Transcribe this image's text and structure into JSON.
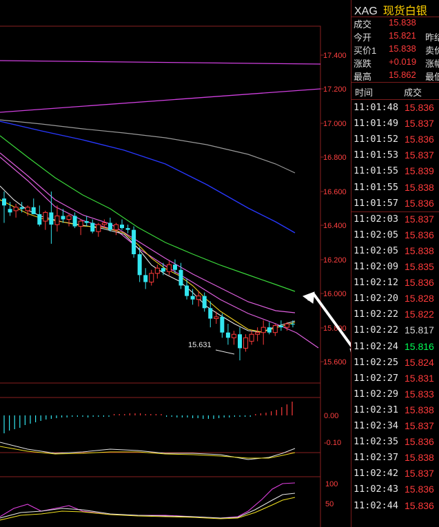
{
  "header": {
    "symbol": "XAG",
    "name": "现货白银"
  },
  "quote_rows": [
    {
      "label": "成交",
      "value": "15.838",
      "extra": ""
    },
    {
      "label": "今开",
      "value": "15.821",
      "extra": "昨结"
    },
    {
      "label": "买价1",
      "value": "15.838",
      "extra": "卖价"
    },
    {
      "label": "涨跌",
      "value": "+0.019",
      "extra": "涨幅"
    },
    {
      "label": "最高",
      "value": "15.862",
      "extra": "最低"
    }
  ],
  "trades_header": {
    "time": "时间",
    "price": "成交"
  },
  "trades": [
    {
      "time": "11:01:48",
      "price": "15.836",
      "dir": "up"
    },
    {
      "time": "11:01:49",
      "price": "15.837",
      "dir": "up"
    },
    {
      "time": "11:01:52",
      "price": "15.836",
      "dir": "up"
    },
    {
      "time": "11:01:53",
      "price": "15.837",
      "dir": "up"
    },
    {
      "time": "11:01:55",
      "price": "15.839",
      "dir": "up"
    },
    {
      "time": "11:01:55",
      "price": "15.838",
      "dir": "up"
    },
    {
      "time": "11:01:57",
      "price": "15.836",
      "dir": "up"
    },
    {
      "time": "11:02:03",
      "price": "15.837",
      "dir": "up"
    },
    {
      "time": "11:02:05",
      "price": "15.836",
      "dir": "up"
    },
    {
      "time": "11:02:05",
      "price": "15.838",
      "dir": "up"
    },
    {
      "time": "11:02:09",
      "price": "15.835",
      "dir": "up"
    },
    {
      "time": "11:02:12",
      "price": "15.836",
      "dir": "up"
    },
    {
      "time": "11:02:20",
      "price": "15.828",
      "dir": "up"
    },
    {
      "time": "11:02:22",
      "price": "15.822",
      "dir": "up"
    },
    {
      "time": "11:02:22",
      "price": "15.817",
      "dir": "flat"
    },
    {
      "time": "11:02:24",
      "price": "15.816",
      "dir": "down"
    },
    {
      "time": "11:02:25",
      "price": "15.824",
      "dir": "up"
    },
    {
      "time": "11:02:27",
      "price": "15.831",
      "dir": "up"
    },
    {
      "time": "11:02:29",
      "price": "15.833",
      "dir": "up"
    },
    {
      "time": "11:02:31",
      "price": "15.838",
      "dir": "up"
    },
    {
      "time": "11:02:34",
      "price": "15.837",
      "dir": "up"
    },
    {
      "time": "11:02:35",
      "price": "15.836",
      "dir": "up"
    },
    {
      "time": "11:02:37",
      "price": "15.838",
      "dir": "up"
    },
    {
      "time": "11:02:42",
      "price": "15.837",
      "dir": "up"
    },
    {
      "time": "11:02:43",
      "price": "15.836",
      "dir": "up"
    },
    {
      "time": "11:02:44",
      "price": "15.836",
      "dir": "up"
    }
  ],
  "price_axis": [
    "17.400",
    "17.200",
    "17.000",
    "16.800",
    "16.600",
    "16.400",
    "16.200",
    "16.000",
    "15.800",
    "15.600"
  ],
  "macd_axis": [
    "0.00",
    "-0.10"
  ],
  "kdj_axis": [
    "100",
    "50"
  ],
  "low_label": "15.631",
  "colors": {
    "up": "#ff3b3b",
    "down": "#00ff55",
    "flat": "#d8d8d8",
    "grid": "#8a1f1f"
  },
  "chart_data": {
    "type": "candlestick",
    "price_range": [
      15.5,
      17.55
    ],
    "candles": [
      {
        "o": 16.56,
        "h": 16.6,
        "l": 16.42,
        "c": 16.52
      },
      {
        "o": 16.5,
        "h": 16.54,
        "l": 16.46,
        "c": 16.48
      },
      {
        "o": 16.49,
        "h": 16.53,
        "l": 16.45,
        "c": 16.51
      },
      {
        "o": 16.51,
        "h": 16.54,
        "l": 16.48,
        "c": 16.5
      },
      {
        "o": 16.49,
        "h": 16.52,
        "l": 16.46,
        "c": 16.51
      },
      {
        "o": 16.51,
        "h": 16.56,
        "l": 16.48,
        "c": 16.47
      },
      {
        "o": 16.47,
        "h": 16.52,
        "l": 16.4,
        "c": 16.41
      },
      {
        "o": 16.43,
        "h": 16.49,
        "l": 16.38,
        "c": 16.48
      },
      {
        "o": 16.48,
        "h": 16.6,
        "l": 16.3,
        "c": 16.41
      },
      {
        "o": 16.41,
        "h": 16.52,
        "l": 16.37,
        "c": 16.46
      },
      {
        "o": 16.46,
        "h": 16.5,
        "l": 16.42,
        "c": 16.44
      },
      {
        "o": 16.44,
        "h": 16.47,
        "l": 16.4,
        "c": 16.46
      },
      {
        "o": 16.46,
        "h": 16.48,
        "l": 16.39,
        "c": 16.4
      },
      {
        "o": 16.4,
        "h": 16.44,
        "l": 16.35,
        "c": 16.43
      },
      {
        "o": 16.43,
        "h": 16.46,
        "l": 16.4,
        "c": 16.42
      },
      {
        "o": 16.42,
        "h": 16.44,
        "l": 16.36,
        "c": 16.37
      },
      {
        "o": 16.37,
        "h": 16.42,
        "l": 16.34,
        "c": 16.41
      },
      {
        "o": 16.41,
        "h": 16.44,
        "l": 16.39,
        "c": 16.42
      },
      {
        "o": 16.42,
        "h": 16.45,
        "l": 16.37,
        "c": 16.38
      },
      {
        "o": 16.38,
        "h": 16.42,
        "l": 16.35,
        "c": 16.41
      },
      {
        "o": 16.41,
        "h": 16.44,
        "l": 16.38,
        "c": 16.39
      },
      {
        "o": 16.39,
        "h": 16.41,
        "l": 16.36,
        "c": 16.38
      },
      {
        "o": 16.38,
        "h": 16.4,
        "l": 16.22,
        "c": 16.24
      },
      {
        "o": 16.24,
        "h": 16.28,
        "l": 16.08,
        "c": 16.12
      },
      {
        "o": 16.12,
        "h": 16.16,
        "l": 16.04,
        "c": 16.08
      },
      {
        "o": 16.08,
        "h": 16.15,
        "l": 16.06,
        "c": 16.13
      },
      {
        "o": 16.13,
        "h": 16.18,
        "l": 16.1,
        "c": 16.16
      },
      {
        "o": 16.16,
        "h": 16.19,
        "l": 16.12,
        "c": 16.14
      },
      {
        "o": 16.14,
        "h": 16.2,
        "l": 16.12,
        "c": 16.18
      },
      {
        "o": 16.18,
        "h": 16.21,
        "l": 16.13,
        "c": 16.15
      },
      {
        "o": 16.15,
        "h": 16.19,
        "l": 16.04,
        "c": 16.06
      },
      {
        "o": 16.06,
        "h": 16.1,
        "l": 15.98,
        "c": 16.0
      },
      {
        "o": 16.0,
        "h": 16.04,
        "l": 15.95,
        "c": 15.98
      },
      {
        "o": 15.98,
        "h": 16.03,
        "l": 15.94,
        "c": 16.0
      },
      {
        "o": 16.0,
        "h": 16.02,
        "l": 15.91,
        "c": 15.93
      },
      {
        "o": 15.93,
        "h": 15.97,
        "l": 15.82,
        "c": 15.87
      },
      {
        "o": 15.87,
        "h": 15.91,
        "l": 15.84,
        "c": 15.88
      },
      {
        "o": 15.88,
        "h": 15.9,
        "l": 15.76,
        "c": 15.79
      },
      {
        "o": 15.79,
        "h": 15.84,
        "l": 15.72,
        "c": 15.76
      },
      {
        "o": 15.76,
        "h": 15.8,
        "l": 15.72,
        "c": 15.78
      },
      {
        "o": 15.78,
        "h": 15.82,
        "l": 15.63,
        "c": 15.7
      },
      {
        "o": 15.7,
        "h": 15.78,
        "l": 15.68,
        "c": 15.76
      },
      {
        "o": 15.74,
        "h": 15.8,
        "l": 15.72,
        "c": 15.78
      },
      {
        "o": 15.78,
        "h": 15.82,
        "l": 15.74,
        "c": 15.79
      },
      {
        "o": 15.79,
        "h": 15.86,
        "l": 15.72,
        "c": 15.82
      },
      {
        "o": 15.82,
        "h": 15.85,
        "l": 15.78,
        "c": 15.79
      },
      {
        "o": 15.79,
        "h": 15.84,
        "l": 15.77,
        "c": 15.83
      },
      {
        "o": 15.83,
        "h": 15.86,
        "l": 15.8,
        "c": 15.82
      },
      {
        "o": 15.82,
        "h": 15.85,
        "l": 15.8,
        "c": 15.84
      },
      {
        "o": 15.84,
        "h": 15.86,
        "l": 15.82,
        "c": 15.836
      }
    ]
  }
}
